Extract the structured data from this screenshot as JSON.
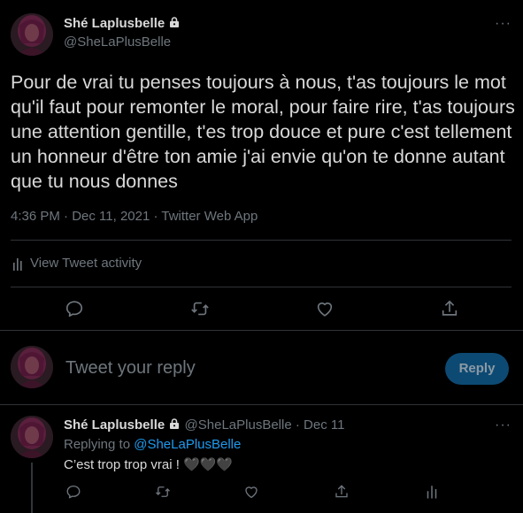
{
  "tweet": {
    "author_name": "Shé Laplusbelle",
    "author_handle": "@SheLaPlusBelle",
    "text": "Pour de vrai tu penses toujours à nous, t'as toujours le mot qu'il faut pour remonter le moral, pour faire rire, t'as toujours une attention gentille, t'es trop douce et pure c'est tellement un honneur d'être ton amie j'ai envie qu'on te donne autant que tu nous donnes",
    "timestamp": "4:36 PM · Dec 11, 2021 · Twitter Web App",
    "activity_label": "View Tweet activity",
    "more_label": "···"
  },
  "composer": {
    "placeholder": "Tweet your reply",
    "reply_button": "Reply"
  },
  "reply": {
    "author_name": "Shé Laplusbelle",
    "author_handle": "@SheLaPlusBelle",
    "date": "· Dec 11",
    "replying_prefix": "Replying to ",
    "replying_handle": "@SheLaPlusBelle",
    "text": "C’est trop trop vrai ! 🖤🖤🖤",
    "more_label": "···"
  },
  "icons": {
    "lock": "lock-icon",
    "reply": "reply-icon",
    "retweet": "retweet-icon",
    "like": "heart-icon",
    "share": "share-icon",
    "analytics": "analytics-icon"
  },
  "colors": {
    "background": "#000000",
    "text": "#d9d9d9",
    "muted": "#6e767d",
    "accent": "#1d9bf0",
    "divider": "#2f3336"
  }
}
